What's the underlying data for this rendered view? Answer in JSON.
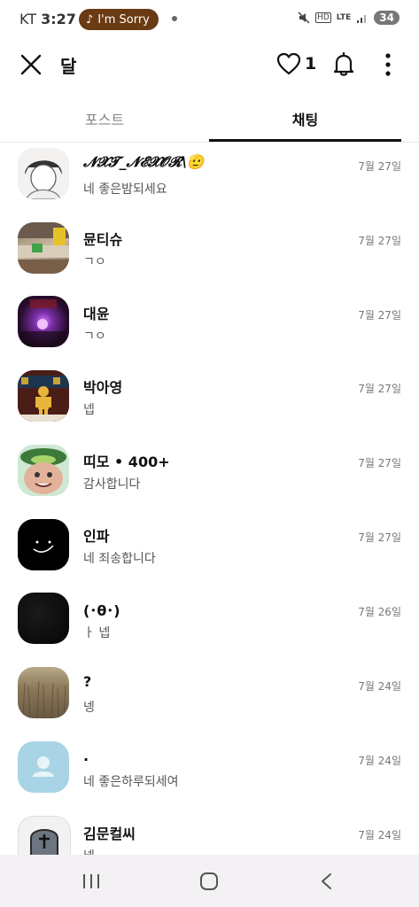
{
  "status": {
    "carrier": "KT",
    "time": "3:27",
    "pill_label": "I'm Sorry",
    "network": "LTE",
    "battery": "34"
  },
  "header": {
    "title": "달",
    "like_count": "1"
  },
  "tabs": [
    {
      "label": "포스트",
      "active": false
    },
    {
      "label": "채팅",
      "active": true
    }
  ],
  "chats": [
    {
      "name": "𝓝𝓧𝓣_𝓝𝓔𝓧𝓞𝓡\\🫡",
      "message": "네 좋은밤되세요",
      "date": "7월 27일"
    },
    {
      "name": "뮨티슈",
      "message": "ㄱㅇ",
      "date": "7월 27일"
    },
    {
      "name": "대윤",
      "message": "ㄱㅇ",
      "date": "7월 27일"
    },
    {
      "name": "박아영",
      "message": "넵",
      "date": "7월 27일"
    },
    {
      "name": "띠모 • 400+",
      "message": "감사합니다",
      "date": "7월 27일"
    },
    {
      "name": "인파",
      "message": "네 죄송합니다",
      "date": "7월 27일"
    },
    {
      "name": "(･θ･)",
      "message": "ㅏ 넵",
      "date": "7월 26일"
    },
    {
      "name": "?",
      "message": "넹",
      "date": "7월 24일"
    },
    {
      "name": ".",
      "message": "네 좋은하루되세여",
      "date": "7월 24일"
    },
    {
      "name": "김문컬씨",
      "message": "넵",
      "date": "7월 24일"
    }
  ]
}
